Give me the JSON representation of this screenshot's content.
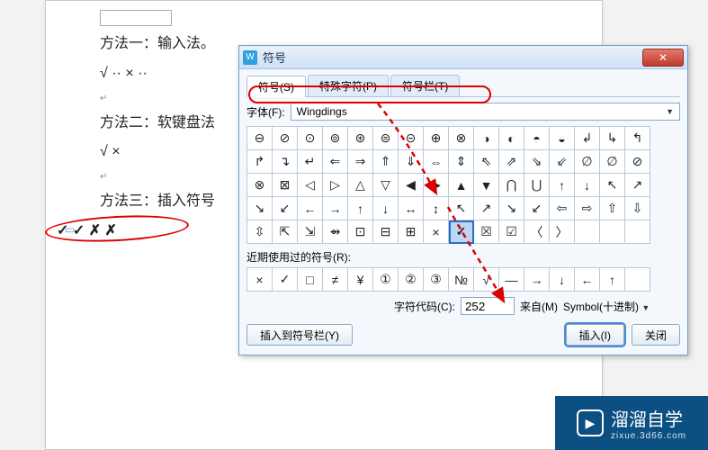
{
  "doc": {
    "l1": "方法一：输入法。",
    "l2": "√ ·· × ··",
    "l3": "方法二：软键盘法",
    "l4": "√ ×",
    "l5": "方法三：插入符号",
    "l6": "✓ ✓ ✗ ✗"
  },
  "dialog": {
    "title": "符号",
    "tabs": {
      "t1": "符号(S)",
      "t2": "特殊字符(P)",
      "t3": "符号栏(T)"
    },
    "font_label": "字体(F):",
    "font_value": "Wingdings",
    "grid": [
      "⊖",
      "⊘",
      "⊙",
      "⊚",
      "⊛",
      "⊜",
      "⊝",
      "⊕",
      "⊗",
      "◑",
      "◐",
      "◓",
      "◒",
      "↲",
      "↳",
      "↰",
      "↱",
      "↴",
      "↵",
      "⇐",
      "⇒",
      "⇑",
      "⇓",
      "⇔",
      "⇕",
      "⇖",
      "⇗",
      "⇘",
      "⇙",
      "∅",
      "∅",
      "⊘",
      "⊗",
      "⊠",
      "◁",
      "▷",
      "△",
      "▽",
      "◀",
      "▶",
      "▲",
      "▼",
      "⋂",
      "⋃",
      "↑",
      "↓",
      "↖",
      "↗",
      "↘",
      "↙",
      "←",
      "→",
      "↑",
      "↓",
      "↔",
      "↕",
      "↖",
      "↗",
      "↘",
      "↙",
      "⇦",
      "⇨",
      "⇧",
      "⇩",
      "⇳",
      "⇱",
      "⇲",
      "⇴",
      "⊡",
      "⊟",
      "⊞",
      "×",
      "✓",
      "☒",
      "☑",
      "〈",
      "〉",
      "",
      "",
      " "
    ],
    "selected_index": 72,
    "recent_label": "近期使用过的符号(R):",
    "recent": [
      "×",
      "✓",
      "□",
      "≠",
      "¥",
      "①",
      "②",
      "③",
      "№",
      "√",
      "—",
      "→",
      "↓",
      "←",
      "↑",
      ""
    ],
    "code_label": "字符代码(C):",
    "code_value": "252",
    "from_label": "来自(M)",
    "from_value": "Symbol(十进制)",
    "btn_bar": "插入到符号栏(Y)",
    "btn_insert": "插入(I)",
    "btn_close": "关闭"
  },
  "watermark": {
    "brand": "溜溜自学",
    "url": "zixue.3d66.com"
  }
}
